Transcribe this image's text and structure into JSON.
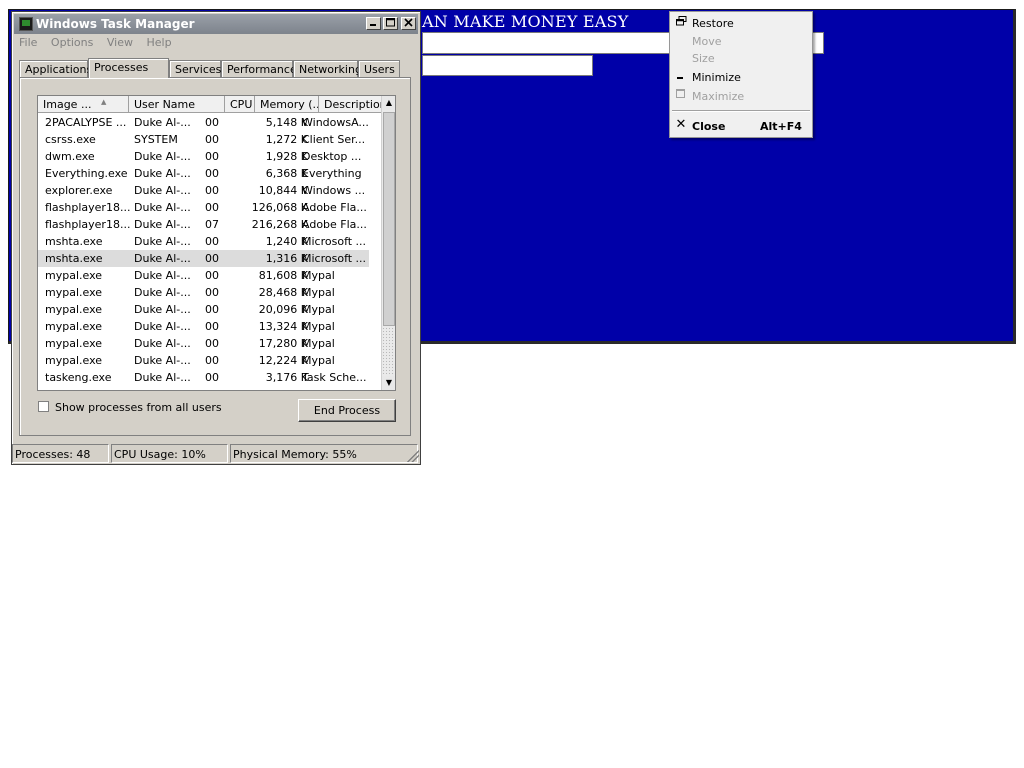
{
  "background_window": {
    "title_text": "AN MAKE MONEY EASY",
    "color": "#0000a8"
  },
  "system_menu": {
    "items": [
      {
        "label": "Restore",
        "icon": "restore-icon",
        "enabled": true
      },
      {
        "label": "Move",
        "icon": "",
        "enabled": false
      },
      {
        "label": "Size",
        "icon": "",
        "enabled": false
      },
      {
        "label": "Minimize",
        "icon": "minimize-icon",
        "enabled": true
      },
      {
        "label": "Maximize",
        "icon": "maximize-icon",
        "enabled": false
      }
    ],
    "close": {
      "label": "Close",
      "shortcut": "Alt+F4",
      "icon": "close-icon"
    }
  },
  "task_manager": {
    "title": "Windows Task Manager",
    "menu": [
      "File",
      "Options",
      "View",
      "Help"
    ],
    "tabs": [
      "Applications",
      "Processes",
      "Services",
      "Performance",
      "Networking",
      "Users"
    ],
    "active_tab": "Processes",
    "columns": [
      "Image ...",
      "User Name",
      "CPU",
      "Memory (...",
      "Description"
    ],
    "processes": [
      {
        "image": "2PACALYPSE ...",
        "user": "Duke Al-...",
        "cpu": "00",
        "memory": "5,148 K",
        "desc": "WindowsA..."
      },
      {
        "image": "csrss.exe",
        "user": "SYSTEM",
        "cpu": "00",
        "memory": "1,272 K",
        "desc": "Client Ser..."
      },
      {
        "image": "dwm.exe",
        "user": "Duke Al-...",
        "cpu": "00",
        "memory": "1,928 K",
        "desc": "Desktop ..."
      },
      {
        "image": "Everything.exe",
        "user": "Duke Al-...",
        "cpu": "00",
        "memory": "6,368 K",
        "desc": "Everything"
      },
      {
        "image": "explorer.exe",
        "user": "Duke Al-...",
        "cpu": "00",
        "memory": "10,844 K",
        "desc": "Windows ..."
      },
      {
        "image": "flashplayer18...",
        "user": "Duke Al-...",
        "cpu": "00",
        "memory": "126,068 K",
        "desc": "Adobe Fla..."
      },
      {
        "image": "flashplayer18...",
        "user": "Duke Al-...",
        "cpu": "07",
        "memory": "216,268 K",
        "desc": "Adobe Fla..."
      },
      {
        "image": "mshta.exe",
        "user": "Duke Al-...",
        "cpu": "00",
        "memory": "1,240 K",
        "desc": "Microsoft ..."
      },
      {
        "image": "mshta.exe",
        "user": "Duke Al-...",
        "cpu": "00",
        "memory": "1,316 K",
        "desc": "Microsoft ...",
        "selected": true
      },
      {
        "image": "mypal.exe",
        "user": "Duke Al-...",
        "cpu": "00",
        "memory": "81,608 K",
        "desc": "Mypal"
      },
      {
        "image": "mypal.exe",
        "user": "Duke Al-...",
        "cpu": "00",
        "memory": "28,468 K",
        "desc": "Mypal"
      },
      {
        "image": "mypal.exe",
        "user": "Duke Al-...",
        "cpu": "00",
        "memory": "20,096 K",
        "desc": "Mypal"
      },
      {
        "image": "mypal.exe",
        "user": "Duke Al-...",
        "cpu": "00",
        "memory": "13,324 K",
        "desc": "Mypal"
      },
      {
        "image": "mypal.exe",
        "user": "Duke Al-...",
        "cpu": "00",
        "memory": "17,280 K",
        "desc": "Mypal"
      },
      {
        "image": "mypal.exe",
        "user": "Duke Al-...",
        "cpu": "00",
        "memory": "12,224 K",
        "desc": "Mypal"
      },
      {
        "image": "taskeng.exe",
        "user": "Duke Al-...",
        "cpu": "00",
        "memory": "3,176 K",
        "desc": "Task Sche..."
      }
    ],
    "show_all_label": "Show processes from all users",
    "show_all_checked": false,
    "end_process_label": "End Process",
    "status": {
      "processes": "Processes: 48",
      "cpu": "CPU Usage: 10%",
      "memory": "Physical Memory: 55%"
    }
  }
}
